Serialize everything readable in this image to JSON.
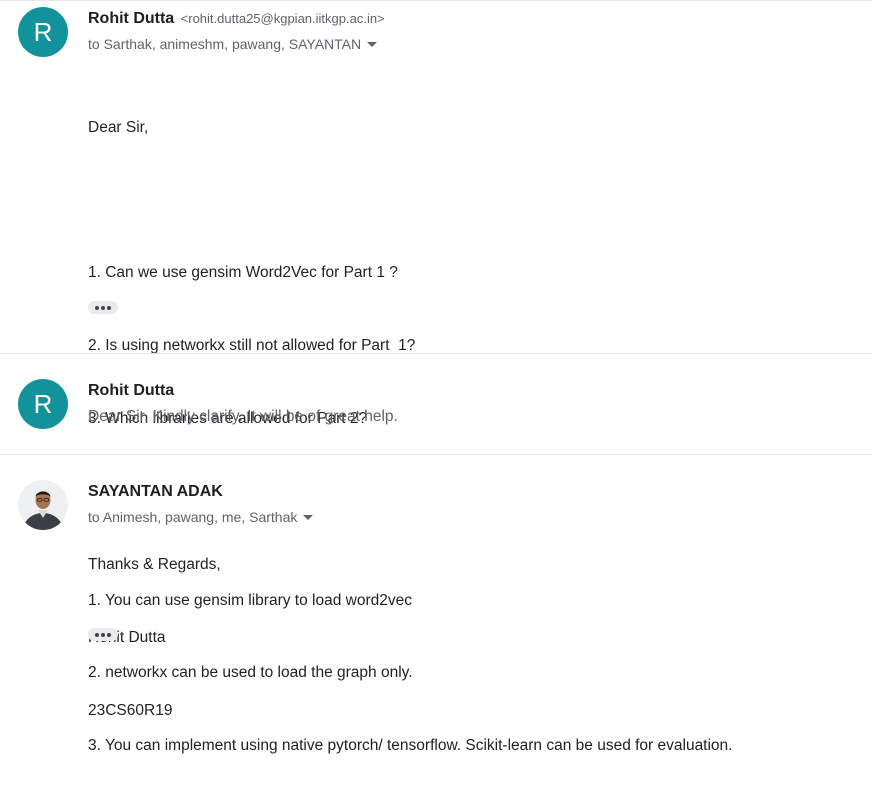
{
  "messages": [
    {
      "avatar_letter": "R",
      "sender": "Rohit Dutta",
      "email": "<rohit.dutta25@kgpian.iitkgp.ac.in>",
      "recipients_prefix": "to ",
      "recipients": "Sarthak, animeshm, pawang, SAYANTAN",
      "body": [
        "Dear Sir,",
        "",
        "1. Can we use gensim Word2Vec for Part 1 ?",
        "2. Is using networkx still not allowed for Part  1?",
        "3. Which libraries are allowed for Part 2?",
        "",
        "Thanks & Regards,",
        "Rohit Dutta",
        "23CS60R19"
      ]
    },
    {
      "avatar_letter": "R",
      "sender": "Rohit Dutta",
      "snippet": "Dear Sir, Kindly clarify. It will be of great help."
    },
    {
      "sender": "SAYANTAN ADAK",
      "recipients_prefix": "to ",
      "recipients_a": "Animesh, pawang, ",
      "recipients_me": "me",
      "recipients_b": ", Sarthak",
      "body": [
        "1. You can use gensim library to load word2vec",
        "2. networkx can be used to load the graph only.",
        "3. You can implement using native pytorch/ tensorflow. Scikit-learn can be used for evaluation."
      ]
    }
  ],
  "colors": {
    "avatar": "#12939c",
    "secondary_text": "#5f6368"
  }
}
